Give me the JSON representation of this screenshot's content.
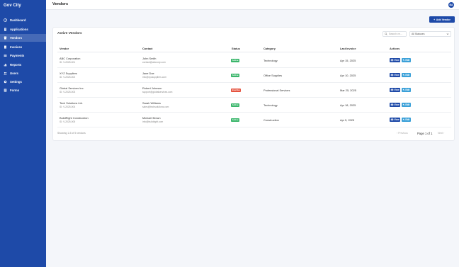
{
  "app": {
    "brand": "Gov City",
    "avatar_initials": "BA"
  },
  "sidebar": {
    "items": [
      {
        "label": "Dashboard",
        "icon": "dashboard-icon",
        "active": false
      },
      {
        "label": "Applications",
        "icon": "document-icon",
        "active": false
      },
      {
        "label": "Vendors",
        "icon": "store-icon",
        "active": true
      },
      {
        "label": "Invoices",
        "icon": "invoice-icon",
        "active": false
      },
      {
        "label": "Payments",
        "icon": "payment-icon",
        "active": false
      },
      {
        "label": "Reports",
        "icon": "chart-icon",
        "active": false
      },
      {
        "label": "Users",
        "icon": "users-icon",
        "active": false
      },
      {
        "label": "Settings",
        "icon": "gear-icon",
        "active": false
      },
      {
        "label": "Forms",
        "icon": "form-icon",
        "active": false
      }
    ]
  },
  "header": {
    "title": "Vendors"
  },
  "actions": {
    "add_vendor": "Add Vendor",
    "add_icon": "plus-icon"
  },
  "card": {
    "title": "Active Vendors",
    "search_placeholder": "Search ve...",
    "status_filter": "All Statuses"
  },
  "table": {
    "columns": [
      "Vendor",
      "Contact",
      "Status",
      "Category",
      "Last Invoice",
      "Actions"
    ],
    "rows": [
      {
        "vendor": "ABC Corporation",
        "vendor_id": "ID: V-2025-001",
        "contact": "John Smith",
        "email": "contact@abccorp.com",
        "status": "Active",
        "category": "Technology",
        "last_invoice": "Apr 15, 2025"
      },
      {
        "vendor": "XYZ Suppliers",
        "vendor_id": "ID: V-2025-002",
        "contact": "Jane Doe",
        "email": "info@xyzsuppliers.com",
        "status": "Active",
        "category": "Office Supplies",
        "last_invoice": "Apr 10, 2025"
      },
      {
        "vendor": "Global Services Inc.",
        "vendor_id": "ID: V-2025-003",
        "contact": "Robert Johnson",
        "email": "support@globalservices.com",
        "status": "Inactive",
        "category": "Professional Services",
        "last_invoice": "Mar 25, 2025"
      },
      {
        "vendor": "Tech Solutions Ltd.",
        "vendor_id": "ID: V-2025-004",
        "contact": "Sarah Williams",
        "email": "sales@techsolutions.com",
        "status": "Active",
        "category": "Technology",
        "last_invoice": "Apr 18, 2025"
      },
      {
        "vendor": "BuildRight Construction",
        "vendor_id": "ID: V-2025-005",
        "contact": "Michael Brown",
        "email": "info@buildright.com",
        "status": "Active",
        "category": "Construction",
        "last_invoice": "Apr 5, 2025"
      }
    ],
    "row_actions": {
      "view": "View",
      "edit": "Edit",
      "view_icon": "eye-icon",
      "edit_icon": "pencil-icon"
    }
  },
  "footer": {
    "showing": "Showing 1-5 of 5 vendors",
    "previous": "‹ Previous",
    "page": "Page 1 of 1",
    "next": "Next ›"
  },
  "colors": {
    "primary": "#1e4aa8",
    "edit": "#3aa0d8",
    "active_badge": "#3ab66b",
    "inactive_badge": "#e5533f"
  }
}
